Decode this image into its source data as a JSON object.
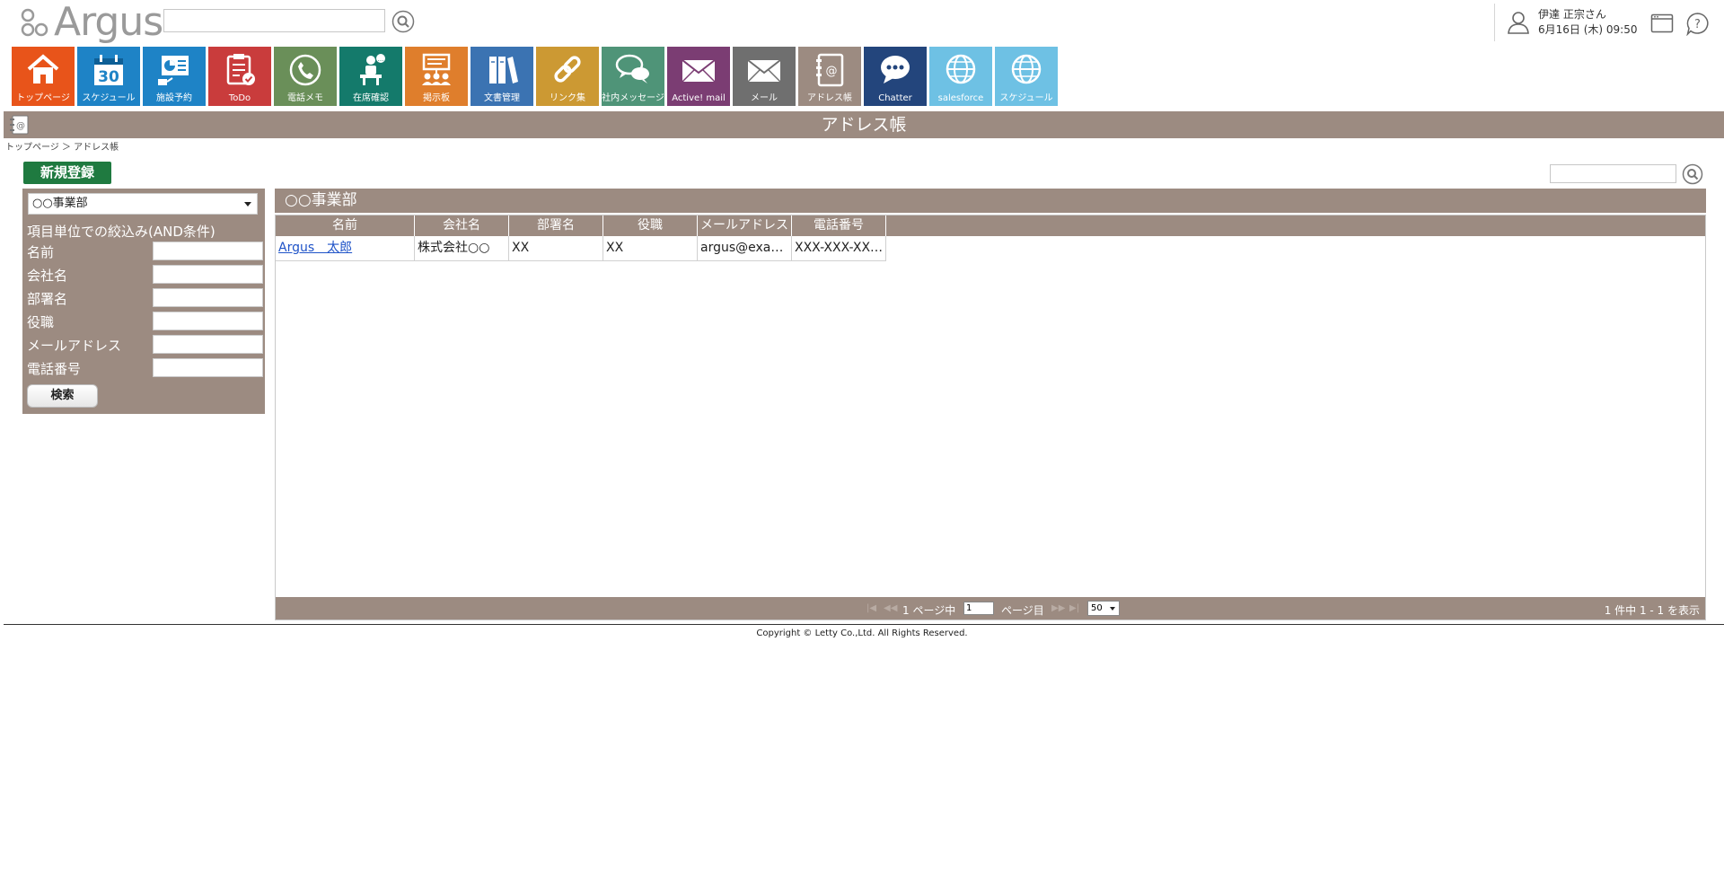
{
  "app": {
    "logo_text": "Argus"
  },
  "header": {
    "search_placeholder": "",
    "user_name": "伊達 正宗さん",
    "datetime": "6月16日 (木) 09:50"
  },
  "apps": [
    {
      "label": "トップページ",
      "icon": "home-icon",
      "color": "#e8541a"
    },
    {
      "label": "スケジュール",
      "icon": "calendar-icon",
      "color": "#1e83c6",
      "day": "30"
    },
    {
      "label": "施設予約",
      "icon": "facility-icon",
      "color": "#1e83c6"
    },
    {
      "label": "ToDo",
      "icon": "todo-icon",
      "color": "#c93c3c"
    },
    {
      "label": "電話メモ",
      "icon": "phone-icon",
      "color": "#6a8f59"
    },
    {
      "label": "在席確認",
      "icon": "presence-icon",
      "color": "#147a6b"
    },
    {
      "label": "掲示板",
      "icon": "board-icon",
      "color": "#df7e2c"
    },
    {
      "label": "文書管理",
      "icon": "document-icon",
      "color": "#3b73b2"
    },
    {
      "label": "リンク集",
      "icon": "link-icon",
      "color": "#cc9933"
    },
    {
      "label": "社内メッセージ",
      "icon": "message-icon",
      "color": "#4f9478"
    },
    {
      "label": "Active! mail",
      "icon": "mail-icon",
      "color": "#7b3d73"
    },
    {
      "label": "メール",
      "icon": "mail-icon",
      "color": "#6f6f6f"
    },
    {
      "label": "アドレス帳",
      "icon": "addressbook-icon",
      "color": "#9c8b81"
    },
    {
      "label": "Chatter",
      "icon": "chatter-icon",
      "color": "#23457c"
    },
    {
      "label": "salesforce",
      "icon": "globe-icon",
      "color": "#6ec1e4"
    },
    {
      "label": "スケジュール",
      "icon": "globe-icon",
      "color": "#6ec1e4"
    }
  ],
  "page": {
    "title": "アドレス帳",
    "breadcrumb": "トップページ ＞ アドレス帳",
    "new_button": "新規登録"
  },
  "filter": {
    "department": "○○事業部",
    "title": "項目単位での絞込み(AND条件)",
    "fields": [
      "名前",
      "会社名",
      "部署名",
      "役職",
      "メールアドレス",
      "電話番号"
    ],
    "search_button": "検索"
  },
  "list": {
    "header": "○○事業部",
    "columns": [
      "名前",
      "会社名",
      "部署名",
      "役職",
      "メールアドレス",
      "電話番号"
    ],
    "rows": [
      [
        "Argus　太郎",
        "株式会社○○",
        "XX",
        "XX",
        "argus@exa…",
        "XXX-XXX-XX…"
      ]
    ]
  },
  "pager": {
    "page_prefix": "1 ページ中",
    "page_value": "1",
    "page_suffix": "ページ目",
    "per_page": "50",
    "summary": "1 件中 1 - 1 を表示"
  },
  "footer": {
    "copyright": "Copyright © Letty Co.,Ltd. All Rights Reserved."
  }
}
